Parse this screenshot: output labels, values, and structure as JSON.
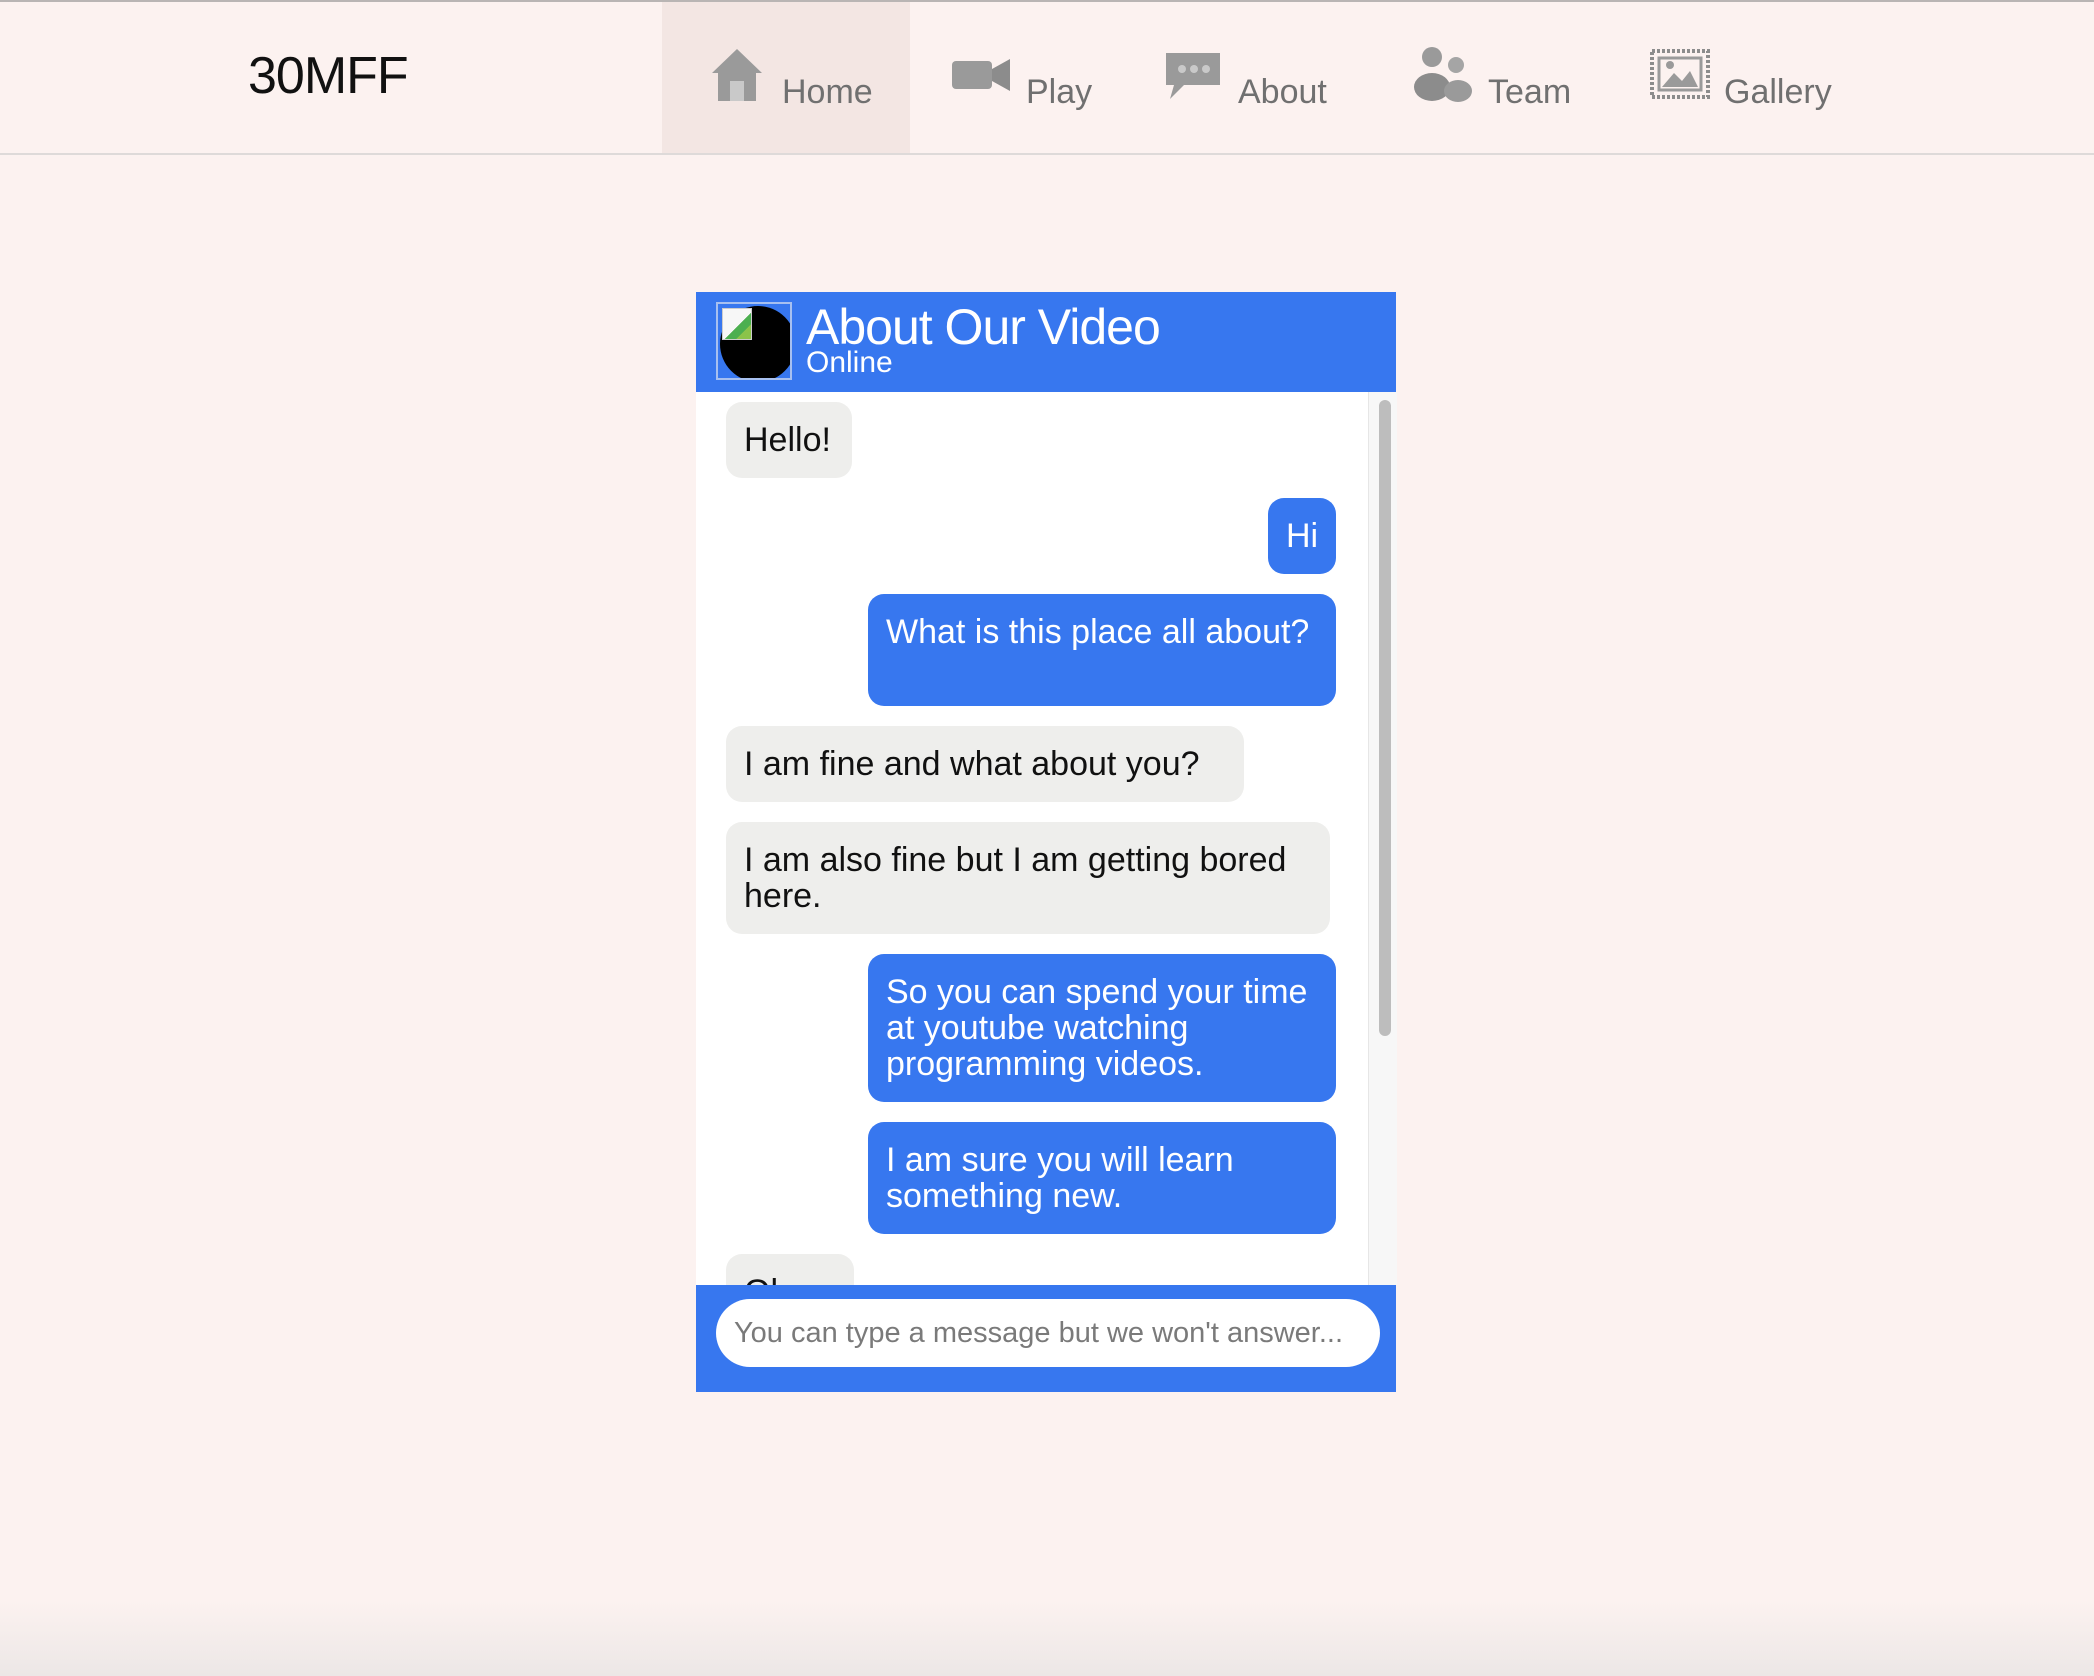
{
  "brand": "30MFF",
  "nav": {
    "items": [
      {
        "label": "Home",
        "icon": "home-icon"
      },
      {
        "label": "Play",
        "icon": "video-camera-icon"
      },
      {
        "label": "About",
        "icon": "speech-bubble-icon"
      },
      {
        "label": "Team",
        "icon": "team-icon"
      },
      {
        "label": "Gallery",
        "icon": "image-icon"
      }
    ],
    "active": "Home"
  },
  "chat": {
    "title": "About Our Video",
    "status": "Online",
    "messages": [
      {
        "from": "in",
        "text": "Hello!"
      },
      {
        "from": "out",
        "text": "Hi"
      },
      {
        "from": "out",
        "text": "What is this place all about?"
      },
      {
        "from": "in",
        "text": "I am fine and what about you?"
      },
      {
        "from": "in",
        "text": "I am also fine but I am getting bored here."
      },
      {
        "from": "out",
        "text": "So you can spend your time at youtube watching programming videos."
      },
      {
        "from": "out",
        "text": "I am sure you will learn something new."
      },
      {
        "from": "in",
        "text": "Ok Sure"
      }
    ],
    "input_placeholder": "You can type a message but we won't answer..."
  },
  "colors": {
    "page_bg": "#fcf2f0",
    "accent": "#3777ef",
    "incoming_bubble": "#eeeeec"
  }
}
